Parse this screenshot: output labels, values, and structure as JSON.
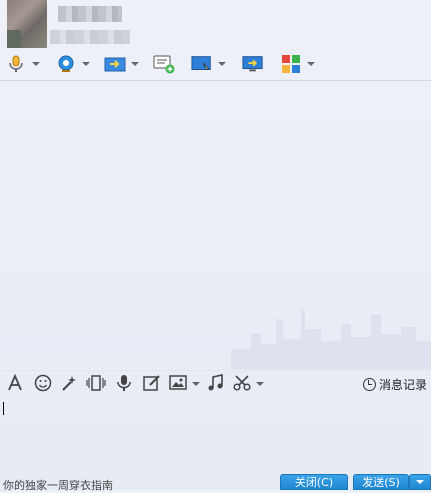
{
  "header": {
    "avatar": "contact-avatar",
    "name": "",
    "signature": ""
  },
  "top_toolbar": {
    "items": [
      {
        "icon": "microphone-call-icon"
      },
      {
        "icon": "webcam-icon"
      },
      {
        "icon": "file-transfer-icon"
      },
      {
        "icon": "new-chat-icon"
      },
      {
        "icon": "remote-assist-icon"
      },
      {
        "icon": "screen-share-icon"
      },
      {
        "icon": "apps-grid-icon"
      }
    ]
  },
  "edit_toolbar": {
    "history_label": "消息记录"
  },
  "input": {
    "value": ""
  },
  "footer": {
    "ad_text": "你的独家一周穿衣指南",
    "close_label": "关闭(C)",
    "send_label": "发送(S)"
  },
  "colors": {
    "accent": "#1f86d0",
    "background": "#eef1f8"
  }
}
